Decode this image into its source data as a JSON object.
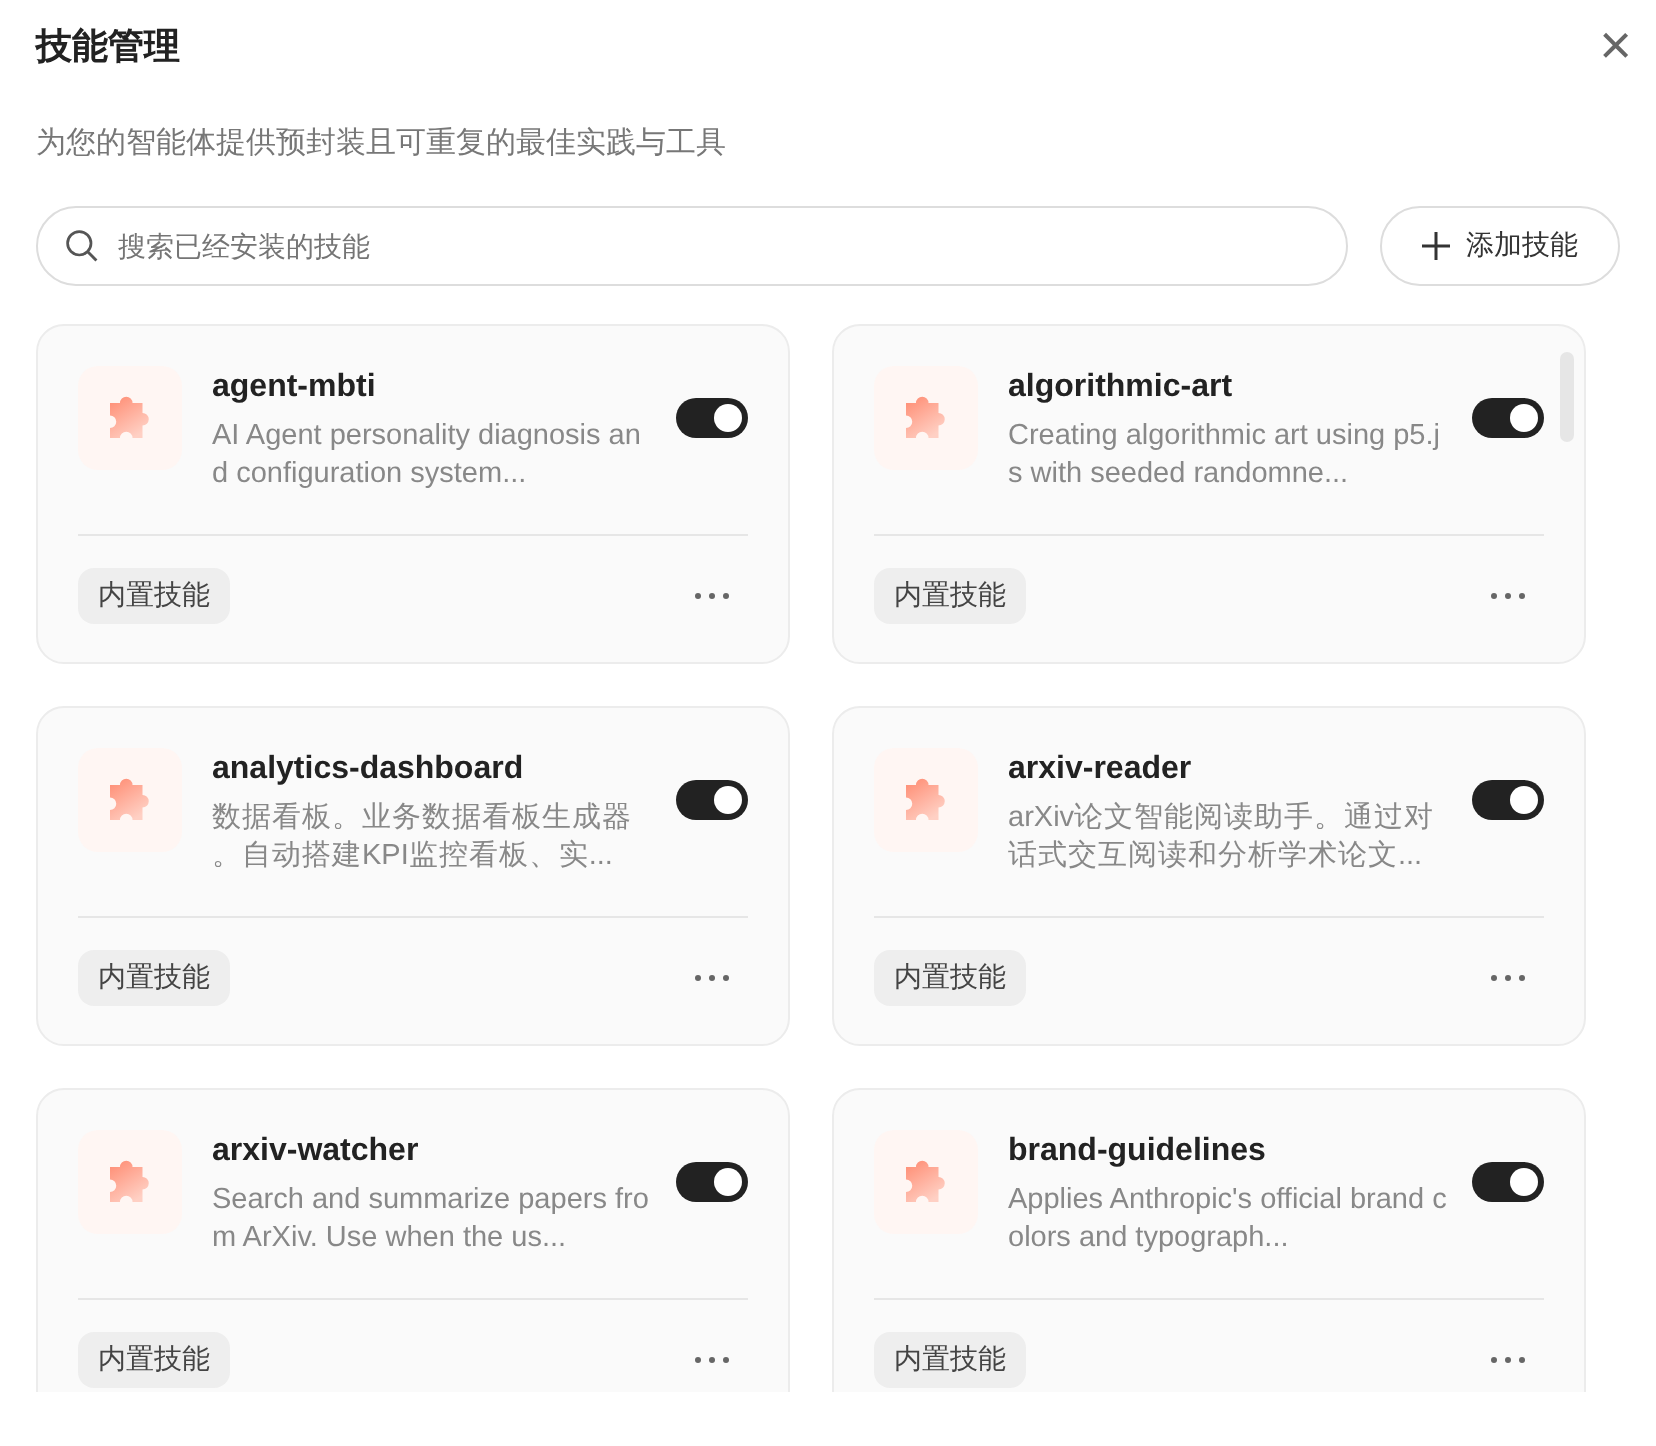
{
  "dialog": {
    "title": "技能管理",
    "close_icon": "×",
    "subtitle": "为您的智能体提供预封装且可重复的最佳实践与工具"
  },
  "search": {
    "placeholder": "搜索已经安装的技能"
  },
  "add_button": {
    "label": "添加技能"
  },
  "skills": [
    {
      "name": "agent-mbti",
      "description": "AI Agent personality diagnosis and configuration system...",
      "on": true,
      "tag": "内置技能"
    },
    {
      "name": "algorithmic-art",
      "description": "Creating algorithmic art using p5.js with seeded randomne...",
      "on": true,
      "tag": "内置技能"
    },
    {
      "name": "analytics-dashboard",
      "description": "数据看板。业务数据看板生成器。自动搭建KPI监控看板、实...",
      "on": true,
      "tag": "内置技能"
    },
    {
      "name": "arxiv-reader",
      "description": "arXiv论文智能阅读助手。通过对话式交互阅读和分析学术论文...",
      "on": true,
      "tag": "内置技能"
    },
    {
      "name": "arxiv-watcher",
      "description": "Search and summarize papers from ArXiv. Use when the us...",
      "on": true,
      "tag": "内置技能"
    },
    {
      "name": "brand-guidelines",
      "description": "Applies Anthropic's official brand colors and typograph...",
      "on": true,
      "tag": "内置技能"
    }
  ]
}
